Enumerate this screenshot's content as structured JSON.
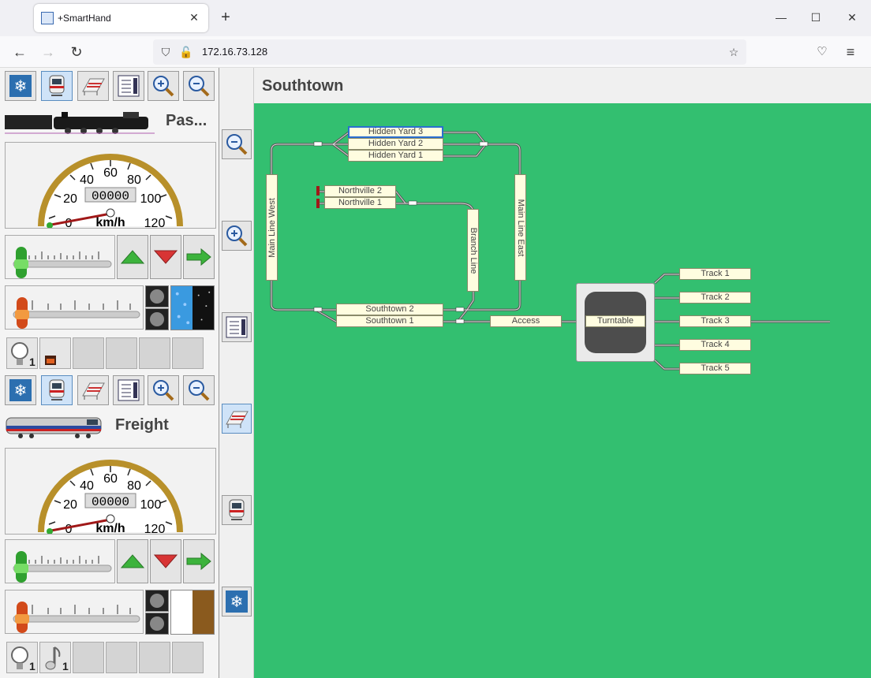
{
  "browser": {
    "tab_title": "+SmartHand",
    "url": "172.16.73.128"
  },
  "throttles": [
    {
      "loco_name": "Pas...",
      "gauge": {
        "counter": "00000",
        "unit": "km/h",
        "ticks": [
          "0",
          "20",
          "40",
          "60",
          "80",
          "100",
          "120"
        ]
      }
    },
    {
      "loco_name": "Freight",
      "gauge": {
        "counter": "00000",
        "unit": "km/h",
        "ticks": [
          "0",
          "20",
          "40",
          "60",
          "80",
          "100",
          "120"
        ]
      }
    }
  ],
  "throttle_functions": [
    {
      "f1_badge": "1",
      "f2_badge": ""
    },
    {
      "f1_badge": "1",
      "f2_badge": "1"
    }
  ],
  "panel": {
    "title": "Southtown",
    "labels": {
      "hidden_yard_3": "Hidden Yard 3",
      "hidden_yard_2": "Hidden Yard 2",
      "hidden_yard_1": "Hidden Yard 1",
      "northville_2": "Northville 2",
      "northville_1": "Northville 1",
      "main_line_west": "Main Line West",
      "main_line_east": "Main Line East",
      "branch_line": "Branch Line",
      "southtown_2": "Southtown 2",
      "southtown_1": "Southtown 1",
      "access": "Access",
      "turntable": "Turntable",
      "track_1": "Track 1",
      "track_2": "Track 2",
      "track_3": "Track 3",
      "track_4": "Track 4",
      "track_5": "Track 5"
    }
  },
  "colors": {
    "layout_bg": "#33bf70",
    "label_bg": "#fffde0",
    "accent": "#2a6fd0"
  }
}
